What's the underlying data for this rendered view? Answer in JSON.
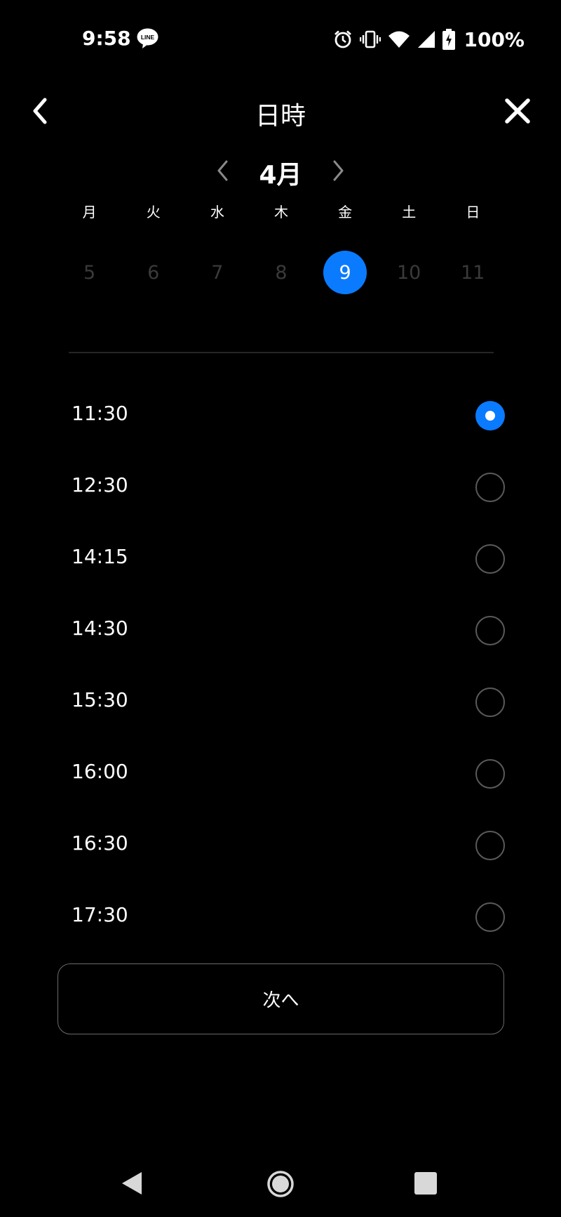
{
  "status_bar": {
    "time": "9:58",
    "notification_icon": "line-app-icon",
    "icons": [
      "alarm-icon",
      "vibrate-icon",
      "wifi-icon",
      "signal-icon",
      "battery-charging-icon"
    ],
    "battery": "100%"
  },
  "header": {
    "title": "日時",
    "back_icon": "chevron-left-icon",
    "close_icon": "close-icon"
  },
  "calendar": {
    "month": "4月",
    "weekdays": [
      "月",
      "火",
      "水",
      "木",
      "金",
      "土",
      "日"
    ],
    "dates": [
      "5",
      "6",
      "7",
      "8",
      "9",
      "10",
      "11"
    ],
    "selected_date": "9"
  },
  "time_slots": {
    "items": [
      {
        "time": "11:30",
        "selected": true
      },
      {
        "time": "12:30",
        "selected": false
      },
      {
        "time": "14:15",
        "selected": false
      },
      {
        "time": "14:30",
        "selected": false
      },
      {
        "time": "15:30",
        "selected": false
      },
      {
        "time": "16:00",
        "selected": false
      },
      {
        "time": "16:30",
        "selected": false
      },
      {
        "time": "17:30",
        "selected": false
      }
    ]
  },
  "actions": {
    "next_label": "次へ"
  },
  "nav_bar": {
    "icons": [
      "nav-back-icon",
      "nav-home-icon",
      "nav-recents-icon"
    ]
  },
  "colors": {
    "background": "#000000",
    "accent": "#0a7bff",
    "text": "#ffffff",
    "disabled_date": "#3a3a3a"
  }
}
